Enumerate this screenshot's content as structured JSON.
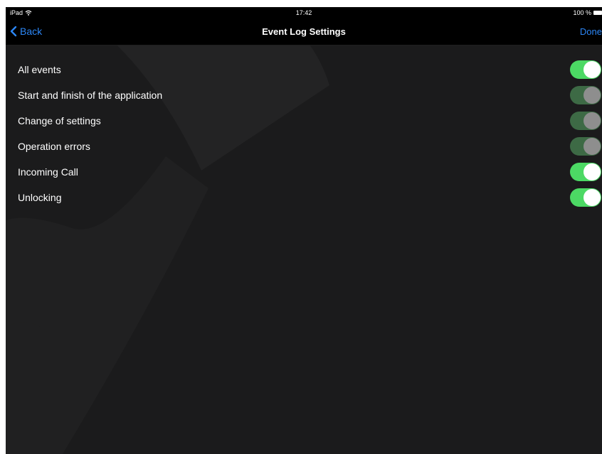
{
  "status_bar": {
    "device": "iPad",
    "wifi_icon": "wifi-icon",
    "time": "17:42",
    "battery": "100 %"
  },
  "nav_bar": {
    "back_label": "Back",
    "title": "Event Log Settings",
    "done_label": "Done"
  },
  "colors": {
    "accent": "#2c86f5",
    "toggle_on": "#4cd964",
    "toggle_on_knob": "#ffffff",
    "toggle_dim": "#3d6a45",
    "toggle_dim_knob": "#8e8e8e",
    "background": "#1b1b1c"
  },
  "settings": [
    {
      "label": "All events",
      "state": "on"
    },
    {
      "label": "Start and finish of the application",
      "state": "dim"
    },
    {
      "label": "Change of settings",
      "state": "dim"
    },
    {
      "label": "Operation errors",
      "state": "dim"
    },
    {
      "label": "Incoming Call",
      "state": "on"
    },
    {
      "label": "Unlocking",
      "state": "on"
    }
  ]
}
